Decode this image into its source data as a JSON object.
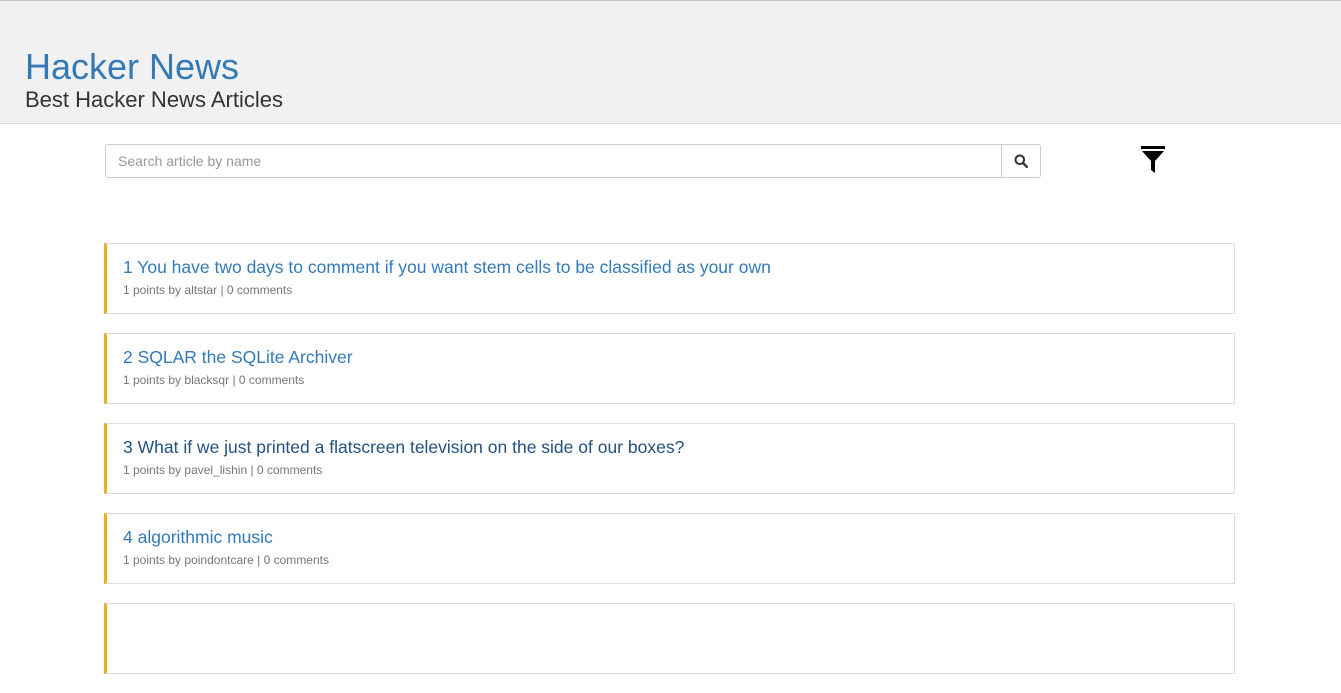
{
  "header": {
    "brand": "Hacker News",
    "subtitle": "Best Hacker News Articles"
  },
  "search": {
    "placeholder": "Search article by name",
    "value": "",
    "button_icon": "search-icon"
  },
  "filter": {
    "icon": "filter-icon"
  },
  "colors": {
    "link": "#337ab7",
    "accent_border": "#f0ad1e",
    "header_bg": "#f1f1f1"
  },
  "articles": [
    {
      "rank": "1",
      "title": "You have two days to comment if you want stem cells to be classified as your own",
      "points": "1 points",
      "by_label": "by",
      "author": "altstar",
      "separator": "|",
      "comments": "0 comments"
    },
    {
      "rank": "2",
      "title": "SQLAR the SQLite Archiver",
      "points": "1 points",
      "by_label": "by",
      "author": "blacksqr",
      "separator": "|",
      "comments": "0 comments"
    },
    {
      "rank": "3",
      "title": "What if we just printed a flatscreen television on the side of our boxes?",
      "points": "1 points",
      "by_label": "by",
      "author": "pavel_lishin",
      "separator": "|",
      "comments": "0 comments"
    },
    {
      "rank": "4",
      "title": "algorithmic music",
      "points": "1 points",
      "by_label": "by",
      "author": "poindontcare",
      "separator": "|",
      "comments": "0 comments"
    }
  ]
}
